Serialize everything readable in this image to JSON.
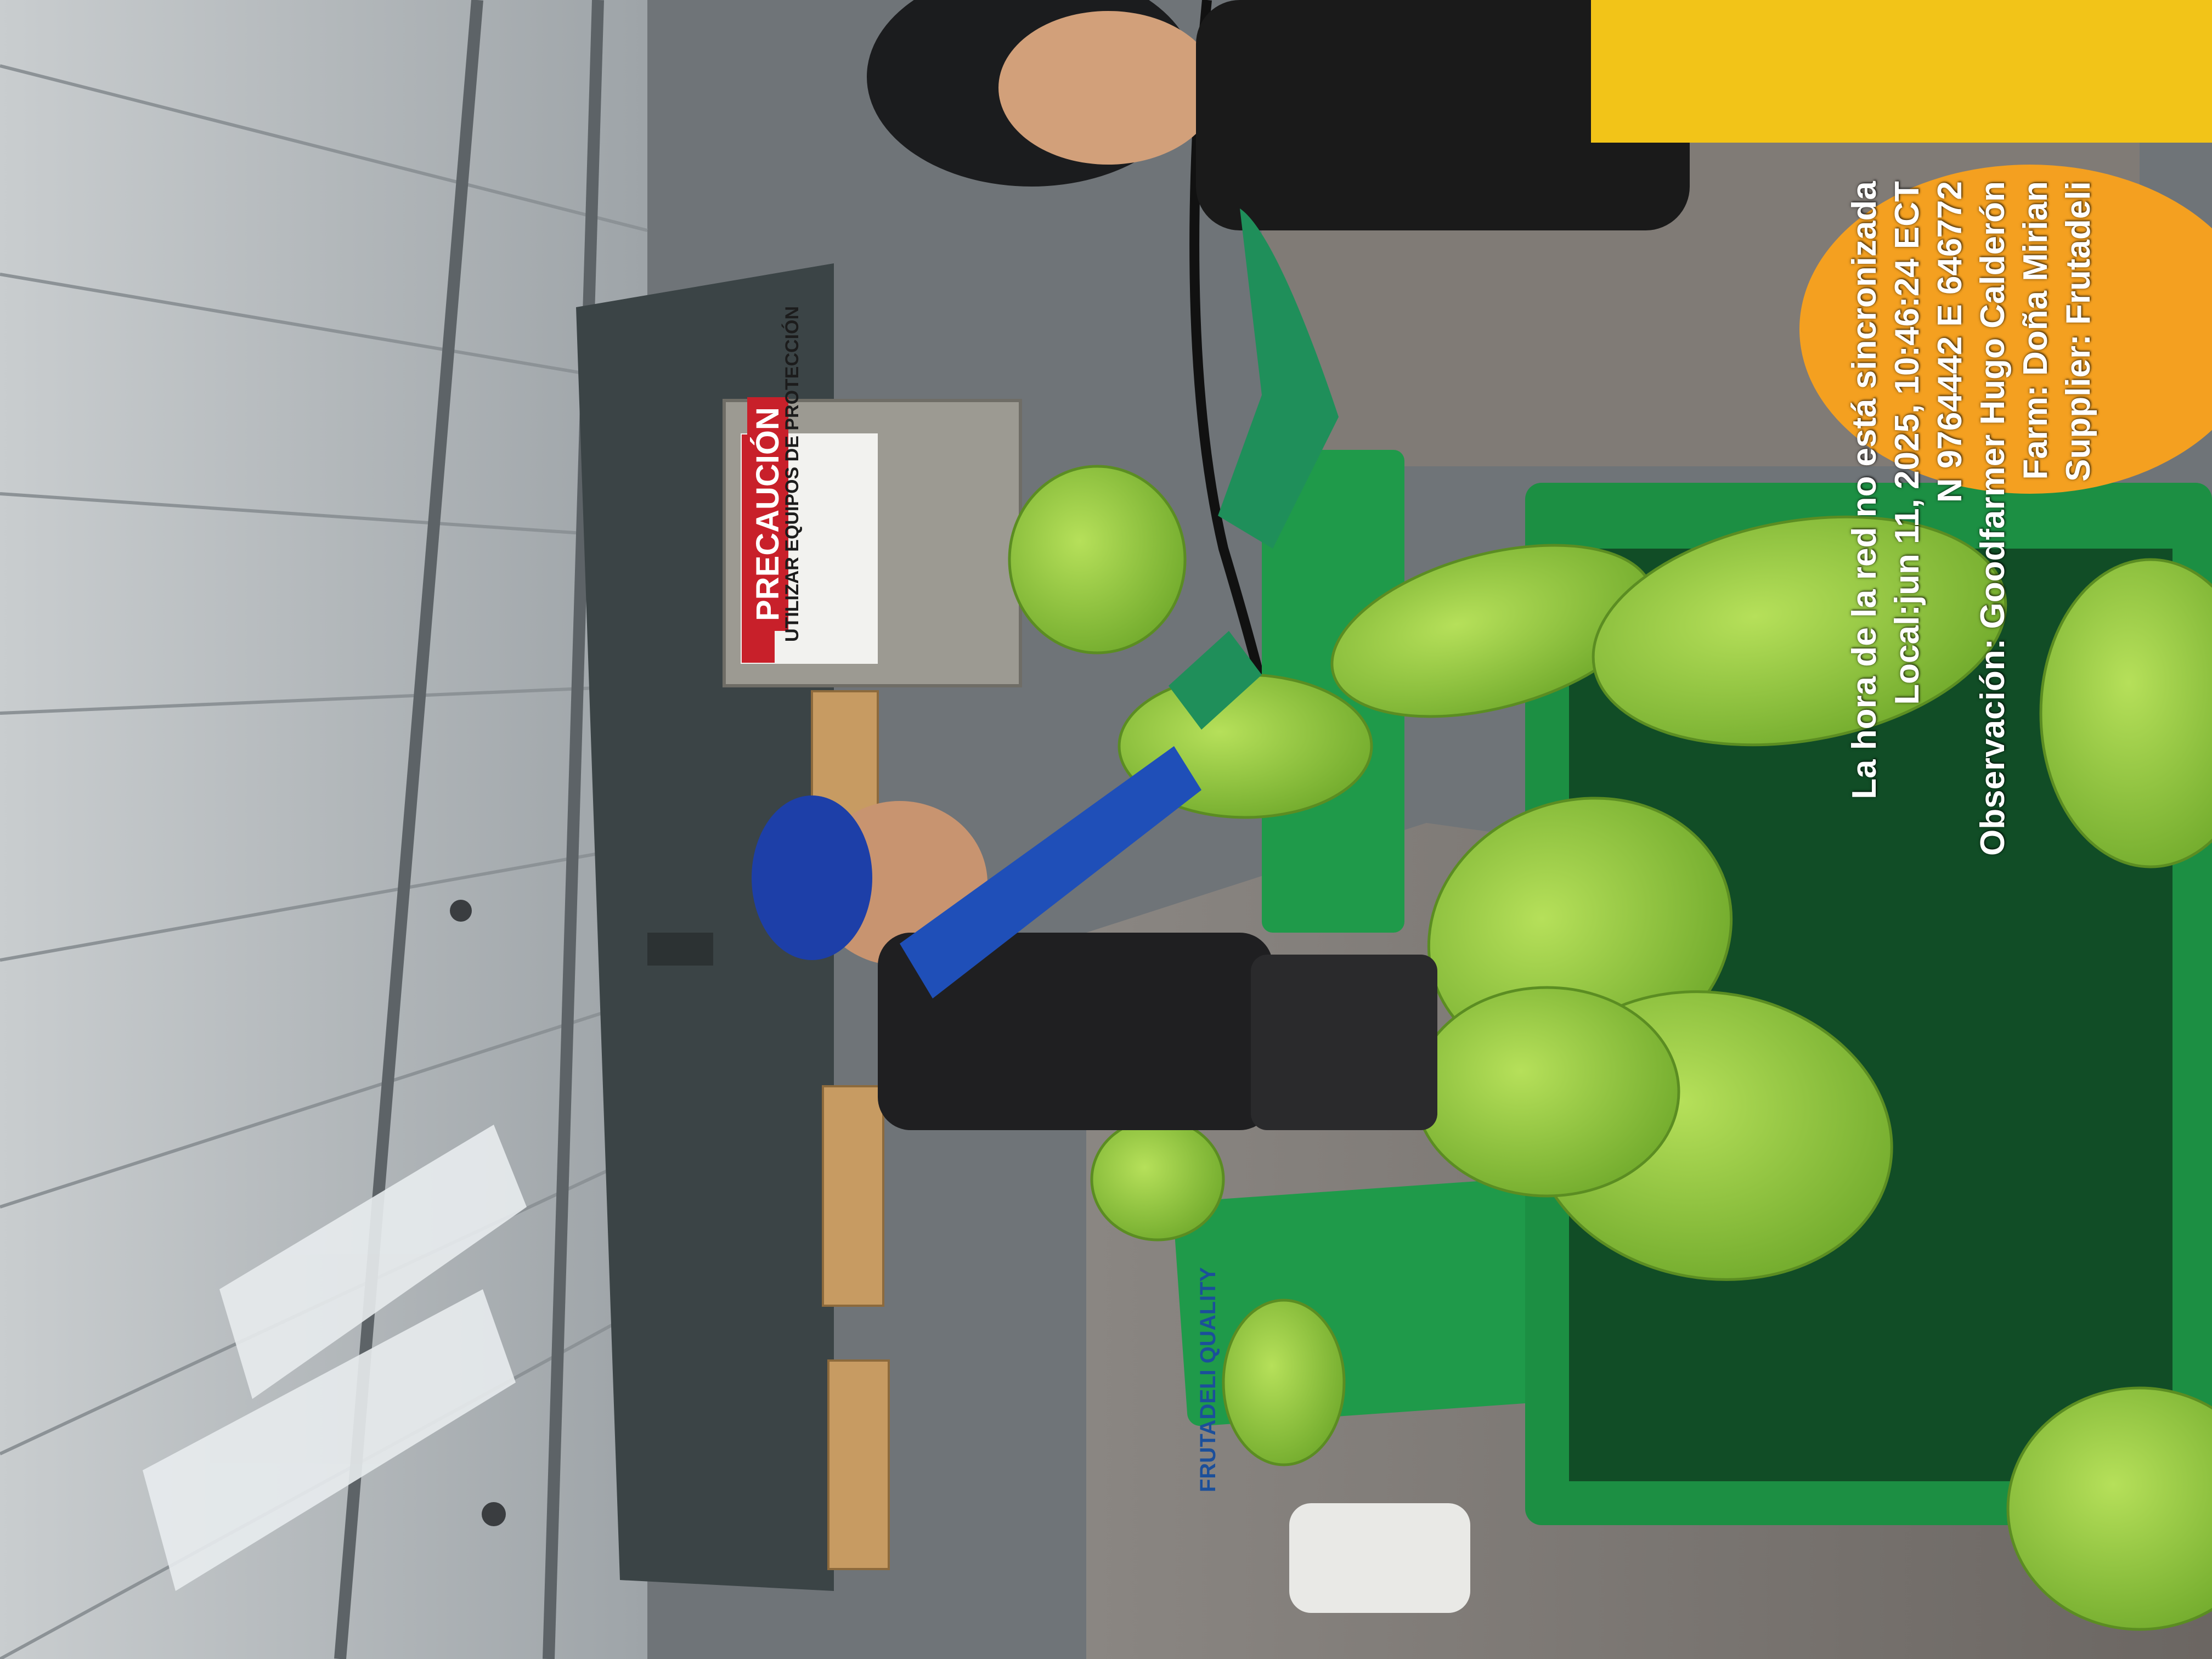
{
  "overlay": {
    "line1": "La hora de la red no está sincronizada",
    "line2": "Local:jun 11, 2025, 10:46:24 ECT",
    "line3": "N 9764442  E 646772",
    "line4": "Observación: Goodfarmer Hugo Calderón",
    "line5": "Farm: Doña Mirian",
    "line6": "Supplier: Frutadeli"
  },
  "sign": {
    "title": "PRECAUCIÓN",
    "subtitle": "UTILIZAR EQUIPOS DE PROTECCIÓN"
  },
  "box_logo": "FRUTADELI QUALITY",
  "colors": {
    "banana_green": "#8fc93a",
    "crate_green": "#1f9a4a",
    "roof_grey": "#b9bdc0",
    "shirt_blue": "#1f4fb8",
    "bucket_orange": "#f4a020",
    "cap_blue": "#1d3fa8"
  }
}
